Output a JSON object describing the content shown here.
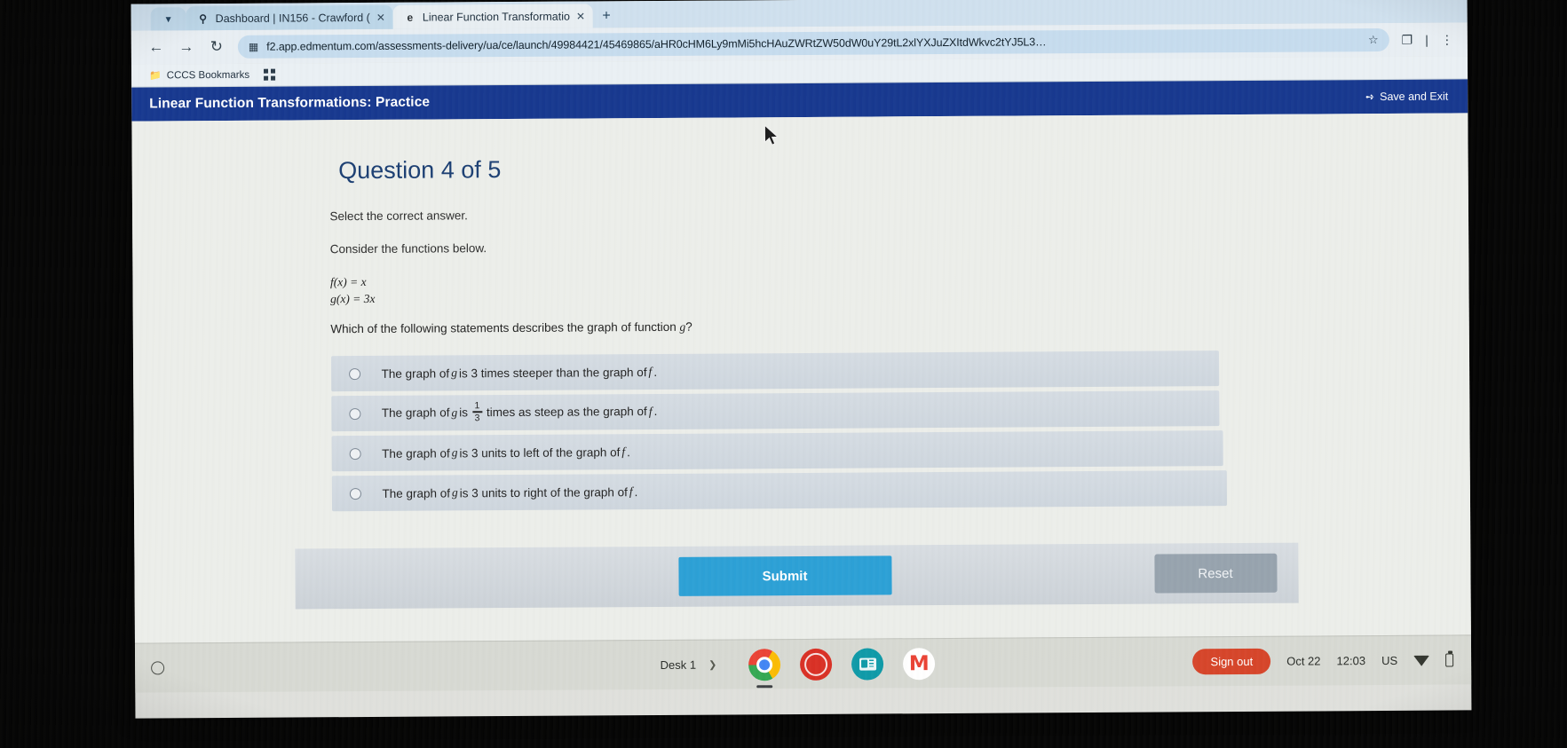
{
  "browser": {
    "tab_chevron_icon": "chevron-down-icon",
    "tabs": [
      {
        "favicon": "location-pin-icon",
        "title": "Dashboard | IN156 - Crawford (",
        "close_label": "✕",
        "active": false
      },
      {
        "favicon": "edmentum-e-icon",
        "title": "Linear Function Transformatio",
        "close_label": "✕",
        "active": true
      }
    ],
    "new_tab_label": "+",
    "back_icon": "arrow-left-icon",
    "forward_icon": "arrow-right-icon",
    "reload_icon": "reload-icon",
    "omnibox": {
      "site_icon": "page-info-icon",
      "url": "f2.app.edmentum.com/assessments-delivery/ua/ce/launch/49984421/45469865/aHR0cHM6Ly9mMi5hcHAuZWRtZW50dW0uY29tL2xlYXJuZXItdWkvc2tYJ5L3…",
      "star_icon": "bookmark-star-icon"
    },
    "toolbar_icons": [
      "extensions-icon",
      "divider",
      "kebab-menu-icon"
    ],
    "bookmarks": [
      {
        "icon": "folder-icon",
        "label": "CCCS Bookmarks"
      }
    ],
    "apps_grid_icon": "apps-grid-icon"
  },
  "app": {
    "title": "Linear Function Transformations: Practice",
    "save_exit": {
      "icon": "exit-arrow-icon",
      "label": "Save and Exit"
    },
    "question_heading": "Question 4 of 5",
    "instruction": "Select the correct answer.",
    "consider_line": "Consider the functions below.",
    "functions": [
      {
        "name": "f",
        "arg": "x",
        "equals": "=",
        "expr": "x",
        "display": "f(x) = x"
      },
      {
        "name": "g",
        "arg": "x",
        "equals": "=",
        "expr": "3x",
        "display": "g(x) = 3x"
      }
    ],
    "question_text_pre": "Which of the following statements describes the graph of function ",
    "question_text_var": "g",
    "question_text_post": "?",
    "options": [
      {
        "id": "opt-a",
        "selected": false,
        "kind": "plain",
        "parts": [
          {
            "t": "text",
            "v": "The graph of "
          },
          {
            "t": "var",
            "v": "g"
          },
          {
            "t": "text",
            "v": " is 3 times steeper than the graph of "
          },
          {
            "t": "var",
            "v": "f"
          },
          {
            "t": "text",
            "v": "."
          }
        ],
        "plain": "The graph of g is 3 times steeper than the graph of f."
      },
      {
        "id": "opt-b",
        "selected": false,
        "kind": "fraction",
        "fraction": {
          "numerator": "1",
          "denominator": "3"
        },
        "parts": [
          {
            "t": "text",
            "v": "The graph of "
          },
          {
            "t": "var",
            "v": "g"
          },
          {
            "t": "text",
            "v": " is "
          },
          {
            "t": "frac",
            "v": "1/3"
          },
          {
            "t": "text",
            "v": " times as steep as the graph of "
          },
          {
            "t": "var",
            "v": "f"
          },
          {
            "t": "text",
            "v": "."
          }
        ],
        "plain": "The graph of g is 1/3 times as steep as the graph of f."
      },
      {
        "id": "opt-c",
        "selected": false,
        "kind": "plain",
        "parts": [
          {
            "t": "text",
            "v": "The graph of "
          },
          {
            "t": "var",
            "v": "g"
          },
          {
            "t": "text",
            "v": " is 3 units to left of the graph of "
          },
          {
            "t": "var",
            "v": "f"
          },
          {
            "t": "text",
            "v": "."
          }
        ],
        "plain": "The graph of g is 3 units to left of the graph of f."
      },
      {
        "id": "opt-d",
        "selected": false,
        "kind": "plain",
        "parts": [
          {
            "t": "text",
            "v": "The graph of "
          },
          {
            "t": "var",
            "v": "g"
          },
          {
            "t": "text",
            "v": " is 3 units to right of the graph of "
          },
          {
            "t": "var",
            "v": "f"
          },
          {
            "t": "text",
            "v": "."
          }
        ],
        "plain": "The graph of g is 3 units to right of the graph of f."
      }
    ],
    "submit_label": "Submit",
    "reset_label": "Reset"
  },
  "shelf": {
    "launcher_icon": "launcher-circle-icon",
    "desk_label": "Desk 1",
    "desk_chevron_icon": "chevron-right-icon",
    "apps": [
      {
        "name": "chrome-icon",
        "label": "Chrome",
        "running": true
      },
      {
        "name": "readwrite-icon",
        "label": "Read&Write",
        "running": false
      },
      {
        "name": "news-icon",
        "label": "News",
        "running": false
      },
      {
        "name": "gmail-icon",
        "label": "Gmail",
        "glyph": "M",
        "running": false
      }
    ],
    "sign_out_label": "Sign out",
    "date": "Oct 22",
    "time": "12:03",
    "locale": "US",
    "wifi_icon": "wifi-icon",
    "battery_icon": "battery-icon"
  },
  "colors": {
    "app_header_blue": "#17388f",
    "submit_blue": "#2ca0d6",
    "reset_gray": "#97a3ae",
    "sign_out_red": "#d6452a",
    "heading_blue": "#1c3f73",
    "option_bg": "#d2d9e1"
  }
}
